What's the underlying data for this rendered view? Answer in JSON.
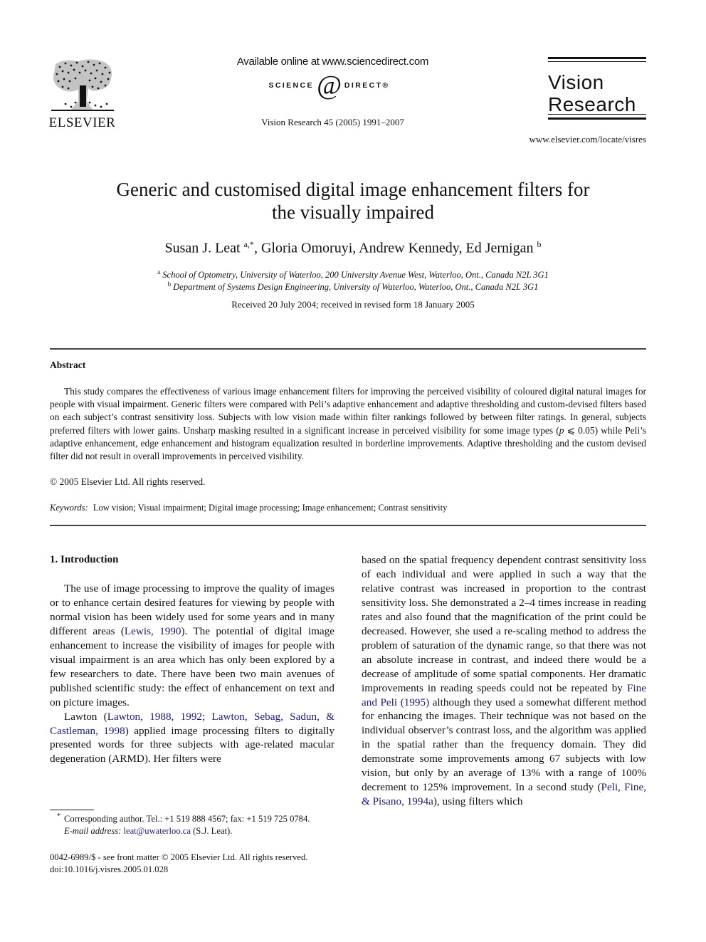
{
  "header": {
    "publisher_logo_text": "ELSEVIER",
    "available_online": "Available online at www.sciencedirect.com",
    "sciencedirect_left": "SCIENCE",
    "sciencedirect_at": "d",
    "sciencedirect_right": "DIRECT®",
    "journal_reference": "Vision Research 45 (2005) 1991–2007",
    "journal_logo_line1": "Vision",
    "journal_logo_line2": "Research",
    "journal_url": "www.elsevier.com/locate/visres"
  },
  "article": {
    "title_line1": "Generic and customised digital image enhancement filters for",
    "title_line2": "the visually impaired",
    "authors": [
      {
        "name": "Susan J. Leat",
        "sup": "a,*"
      },
      {
        "name": "Gloria Omoruyi",
        "sup": ""
      },
      {
        "name": "Andrew Kennedy",
        "sup": ""
      },
      {
        "name": "Ed Jernigan",
        "sup": "b"
      }
    ],
    "affiliations": [
      {
        "mark": "a",
        "text": "School of Optometry, University of Waterloo, 200 University Avenue West, Waterloo, Ont., Canada N2L 3G1"
      },
      {
        "mark": "b",
        "text": "Department of Systems Design Engineering, University of Waterloo, Waterloo, Ont., Canada N2L 3G1"
      }
    ],
    "received": "Received 20 July 2004; received in revised form 18 January 2005"
  },
  "abstract": {
    "heading": "Abstract",
    "body_part1": "This study compares the effectiveness of various image enhancement filters for improving the perceived visibility of coloured digital natural images for people with visual impairment. Generic filters were compared with Peli’s adaptive enhancement and adaptive thresholding and custom-devised filters based on each subject’s contrast sensitivity loss. Subjects with low vision made within filter rankings followed by between filter ratings. In general, subjects preferred filters with lower gains. Unsharp masking resulted in a significant increase in perceived visibility for some image types (",
    "body_p": "p",
    "body_part2": " ⩽ 0.05) while Peli’s adaptive enhancement, edge enhancement and histogram equalization resulted in borderline improvements. Adaptive thresholding and the custom devised filter did not result in overall improvements in perceived visibility.",
    "copyright": "© 2005 Elsevier Ltd. All rights reserved.",
    "keywords_label": "Keywords:",
    "keywords": "Low vision; Visual impairment; Digital image processing; Image enhancement; Contrast sensitivity"
  },
  "introduction": {
    "heading": "1. Introduction",
    "p1_a": "The use of image processing to improve the quality of images or to enhance certain desired features for viewing by people with normal vision has been widely used for some years and in many different areas (",
    "p1_link": "Lewis, 1990",
    "p1_b": "). The potential of digital image enhancement to increase the visibility of images for people with visual impairment is an area which has only been explored by a few researchers to date. There have been two main avenues of published scientific study: the effect of enhancement on text and on picture images.",
    "p2_a": "Lawton (",
    "p2_link": "Lawton, 1988, 1992; Lawton, Sebag, Sadun, & Castleman, 1998",
    "p2_b": ") applied image processing filters to digitally presented words for three subjects with age-related macular degeneration (ARMD). Her filters were",
    "p3_a": "based on the spatial frequency dependent contrast sensitivity loss of each individual and were applied in such a way that the relative contrast was increased in proportion to the contrast sensitivity loss. She demonstrated a 2–4 times increase in reading rates and also found that the magnification of the print could be decreased. However, she used a re-scaling method to address the problem of saturation of the dynamic range, so that there was not an absolute increase in contrast, and indeed there would be a decrease of amplitude of some spatial components. Her dramatic improvements in reading speeds could not be repeated by ",
    "p3_link1": "Fine and Peli (1995)",
    "p3_b": " although they used a somewhat different method for enhancing the images. Their technique was not based on the individual observer’s contrast loss, and the algorithm was applied in the spatial rather than the frequency domain. They did demonstrate some improvements among 67 subjects with low vision, but only by an average of 13% with a range of 100% decrement to 125% improvement. In a second study (",
    "p3_link2": "Peli, Fine, & Pisano, 1994a",
    "p3_c": "), using filters which"
  },
  "footnote": {
    "star": "*",
    "corresponding": "Corresponding author. Tel.: +1 519 888 4567; fax: +1 519 725 0784.",
    "email_label": "E-mail address:",
    "email": "leat@uwaterloo.ca",
    "email_suffix": " (S.J. Leat)."
  },
  "front_matter": {
    "line1": "0042-6989/$ - see front matter © 2005 Elsevier Ltd. All rights reserved.",
    "doi": "doi:10.1016/j.visres.2005.01.028"
  },
  "colors": {
    "link": "#1a1a7a",
    "text": "#111111"
  }
}
